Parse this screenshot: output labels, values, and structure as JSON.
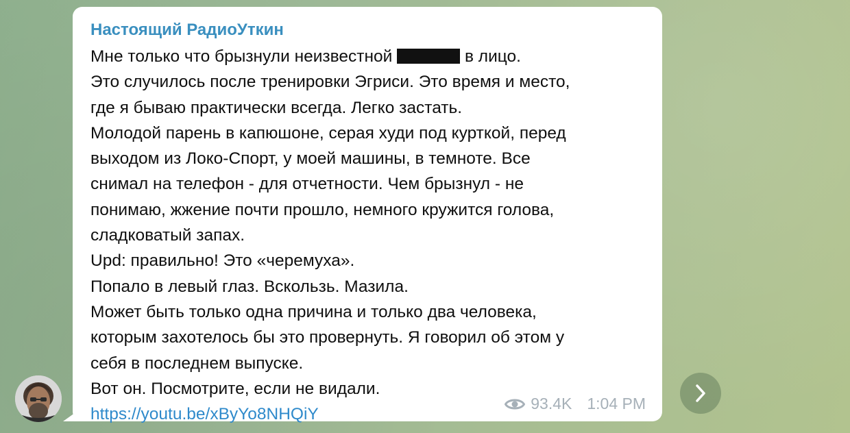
{
  "message": {
    "channel_name": "Настоящий РадиоУткин",
    "first_line_before": "Мне только что брызнули неизвестной",
    "first_line_after": "в лицо.",
    "lines": [
      "Это случилось после тренировки Эгриси. Это время и место,",
      "где я бываю практически всегда. Легко застать.",
      "Молодой парень в капюшоне, серая худи под курткой, перед",
      "выходом из Локо-Спорт, у моей машины, в темноте. Все",
      "снимал на телефон - для отчетности. Чем брызнул - не",
      "понимаю, жжение почти прошло, немного кружится голова,",
      "сладковатый запах.",
      "Upd: правильно! Это «черемуха».",
      "Попало в левый глаз. Вскользь. Мазила.",
      "Может быть только одна причина и только два человека,",
      "которым захотелось бы это провернуть. Я говорил об этом у",
      "себя в последнем выпуске.",
      "Вот он. Посмотрите, если не видали."
    ],
    "link": "https://youtu.be/xByYo8NHQiY",
    "views": "93.4K",
    "time": "1:04 PM"
  },
  "icons": {
    "views": "eye-icon",
    "share": "chevron-right-icon"
  },
  "colors": {
    "channel_name": "#3a8fbf",
    "link": "#2f8acb",
    "meta": "#a6b0b8",
    "bubble": "#ffffff",
    "background": "#9db896"
  }
}
